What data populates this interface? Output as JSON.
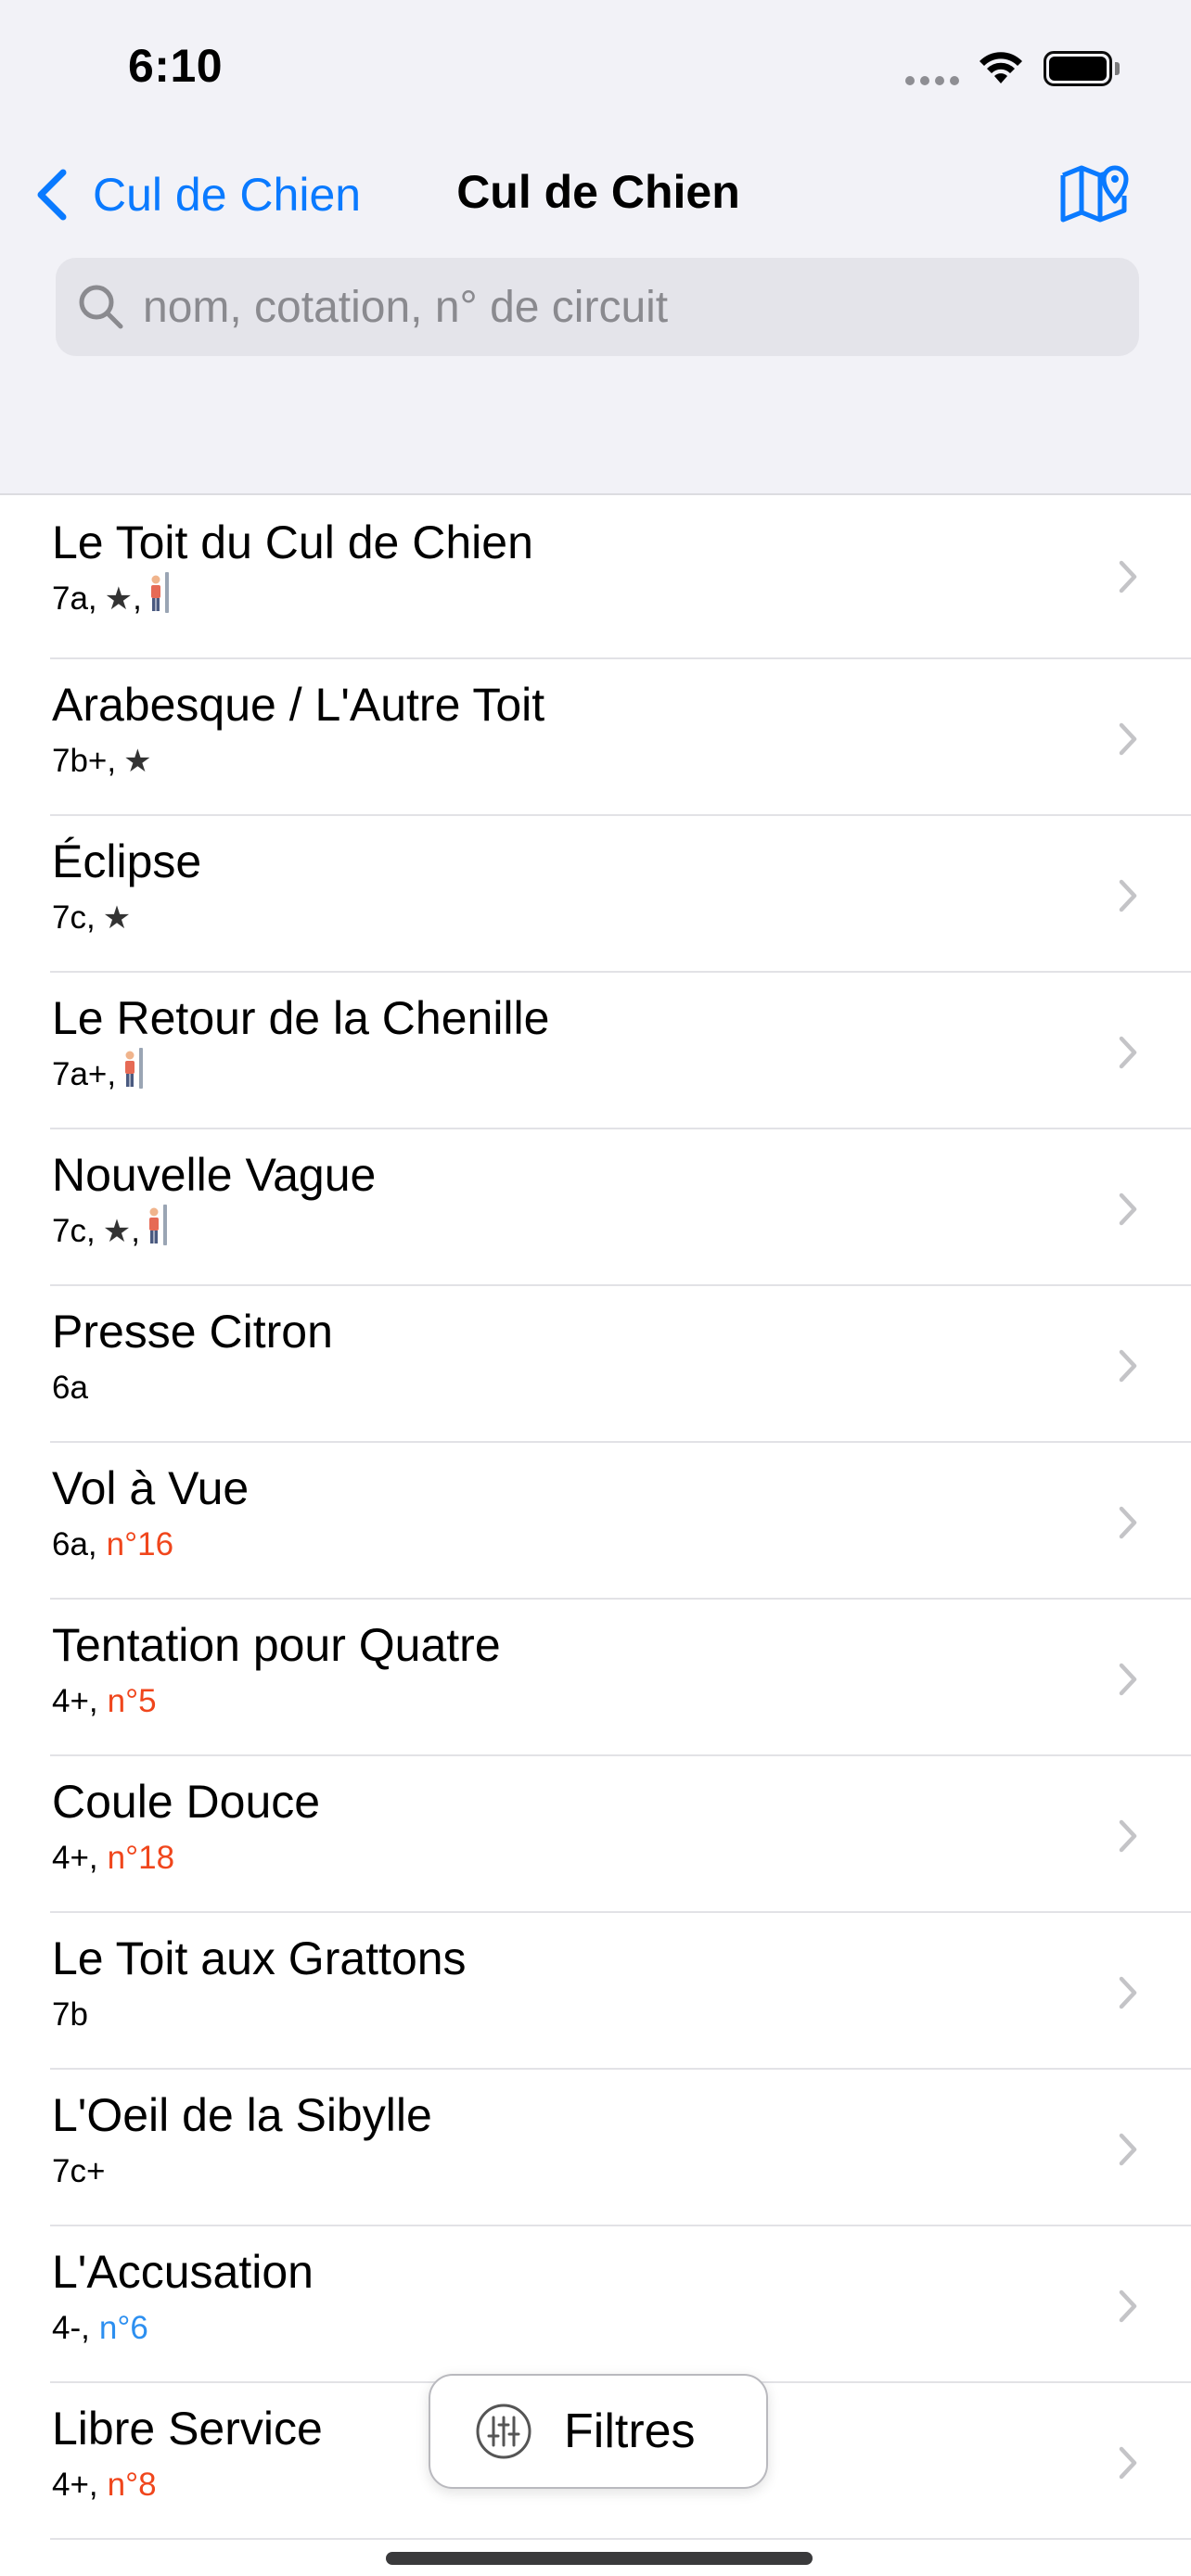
{
  "status_bar": {
    "time": "6:10"
  },
  "nav": {
    "back_label": "Cul de Chien",
    "title": "Cul de Chien",
    "accent_color": "#0a7aff"
  },
  "search": {
    "placeholder": "nom, cotation, n° de circuit",
    "value": ""
  },
  "problems": [
    {
      "name": "Le Toit du Cul de Chien",
      "grade": "7a,",
      "star": "★",
      "highball": true
    },
    {
      "name": "Arabesque / L'Autre Toit",
      "grade": "7b+,",
      "star": "★"
    },
    {
      "name": "Éclipse",
      "grade": "7c,",
      "star": "★"
    },
    {
      "name": "Le Retour de la Chenille",
      "grade": "7a+,",
      "highball": true
    },
    {
      "name": "Nouvelle Vague",
      "grade": "7c,",
      "star": "★",
      "highball": true
    },
    {
      "name": "Presse Citron",
      "grade": "6a"
    },
    {
      "name": "Vol à Vue",
      "grade": "6a,",
      "circuit": "n°16",
      "circuit_color": "orange"
    },
    {
      "name": "Tentation pour Quatre",
      "grade": "4+,",
      "circuit": "n°5",
      "circuit_color": "orange"
    },
    {
      "name": "Coule Douce",
      "grade": "4+,",
      "circuit": "n°18",
      "circuit_color": "orange"
    },
    {
      "name": "Le Toit aux Grattons",
      "grade": "7b"
    },
    {
      "name": "L'Oeil de la Sibylle",
      "grade": "7c+"
    },
    {
      "name": "L'Accusation",
      "grade": "4-,",
      "circuit": "n°6",
      "circuit_color": "blue"
    },
    {
      "name": "Libre Service",
      "grade": "4+,",
      "circuit": "n°8",
      "circuit_color": "orange"
    }
  ],
  "filter_button": {
    "label": "Filtres"
  }
}
